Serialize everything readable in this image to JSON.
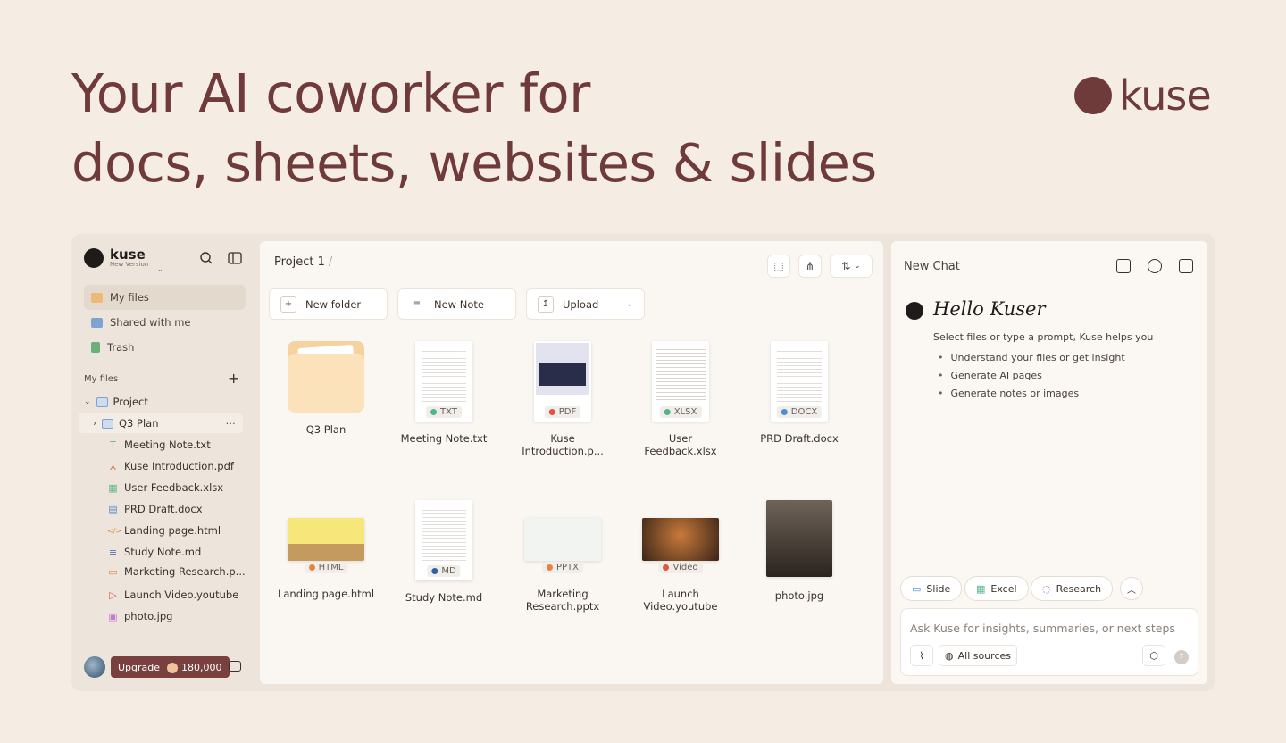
{
  "hero": {
    "line1": "Your AI coworker for",
    "line2": "docs, sheets, websites & slides"
  },
  "brand": {
    "name": "kuse"
  },
  "sidebar": {
    "logo_name": "kuse",
    "logo_sub": "New Version",
    "nav": [
      {
        "label": "My files",
        "color": "#f0b876"
      },
      {
        "label": "Shared with me",
        "color": "#7ea3d0"
      },
      {
        "label": "Trash",
        "color": "#6bb07a"
      }
    ],
    "section_label": "My files",
    "tree": {
      "project": "Project",
      "folder": "Q3 Plan",
      "files": [
        {
          "label": "Meeting Note.txt",
          "icon": "T",
          "color": "#63b08a"
        },
        {
          "label": "Kuse Introduction.pdf",
          "icon": "⅄",
          "color": "#e06a4a"
        },
        {
          "label": "User Feedback.xlsx",
          "icon": "▦",
          "color": "#5fb784"
        },
        {
          "label": "PRD Draft.docx",
          "icon": "▤",
          "color": "#5a8fce"
        },
        {
          "label": "Landing page.html",
          "icon": "</>",
          "color": "#e5843e"
        },
        {
          "label": "Study Note.md",
          "icon": "≡",
          "color": "#4d72b8"
        },
        {
          "label": "Marketing Research.p...",
          "icon": "▭",
          "color": "#e5843e"
        },
        {
          "label": "Launch Video.youtube",
          "icon": "▷",
          "color": "#e05a5a"
        },
        {
          "label": "photo.jpg",
          "icon": "▣",
          "color": "#c27ad0"
        }
      ]
    },
    "upgrade_label": "Upgrade",
    "credits": "180,000"
  },
  "main": {
    "breadcrumb": "Project 1",
    "breadcrumb_sep": "/",
    "actions": {
      "new_folder": "New folder",
      "new_note": "New Note",
      "upload": "Upload"
    },
    "tiles": [
      {
        "name": "Q3 Plan",
        "kind": "folder"
      },
      {
        "name": "Meeting Note.txt",
        "badge": "TXT",
        "dot": "#4fb58c"
      },
      {
        "name": "Kuse Introduction.p...",
        "badge": "PDF",
        "dot": "#e25545"
      },
      {
        "name": "User Feedback.xlsx",
        "badge": "XLSX",
        "dot": "#4fb58c"
      },
      {
        "name": "PRD Draft.docx",
        "badge": "DOCX",
        "dot": "#4a8fd0"
      },
      {
        "name": "Landing page.html",
        "badge": "HTML",
        "dot": "#e5843e"
      },
      {
        "name": "Study Note.md",
        "badge": "MD",
        "dot": "#2f5fa8"
      },
      {
        "name": "Marketing Research.pptx",
        "badge": "PPTX",
        "dot": "#e5843e"
      },
      {
        "name": "Launch Video.youtube",
        "badge": "Video",
        "dot": "#e25545"
      },
      {
        "name": "photo.jpg",
        "kind": "photo"
      }
    ]
  },
  "chat": {
    "title": "New Chat",
    "greeting": "Hello Kuser",
    "hint": "Select files or type a prompt, Kuse helps you",
    "bullets": [
      "Understand your files or get insight",
      "Generate AI pages",
      "Generate notes or images"
    ],
    "chips": {
      "slide": "Slide",
      "excel": "Excel",
      "research": "Research"
    },
    "placeholder": "Ask Kuse for insights, summaries, or next steps",
    "sources": "All sources"
  }
}
